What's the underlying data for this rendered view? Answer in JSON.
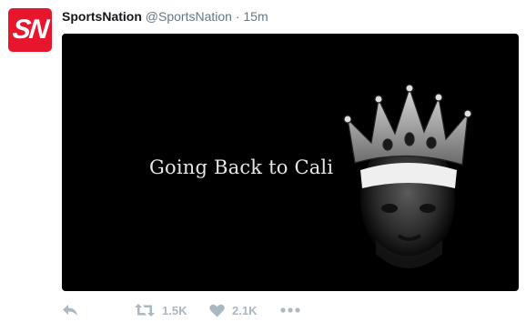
{
  "tweet": {
    "author": {
      "name": "SportsNation",
      "handle": "@SportsNation",
      "avatar_text": "SN",
      "avatar_color": "#e8162c"
    },
    "separator": "·",
    "time": "15m",
    "media": {
      "caption": "Going Back to Cali",
      "background": "#000000"
    },
    "actions": {
      "reply_icon": "reply-icon",
      "retweet_icon": "retweet-icon",
      "retweet_count": "1.5K",
      "like_icon": "heart-icon",
      "like_count": "2.1K",
      "more_icon": "more-icon"
    }
  },
  "colors": {
    "name": "#14171a",
    "meta": "#657786",
    "action": "#aab8c2"
  }
}
